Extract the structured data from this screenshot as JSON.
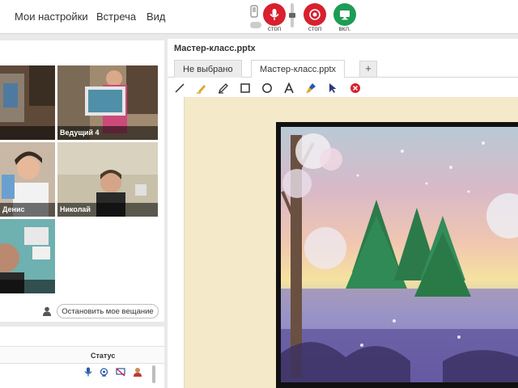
{
  "menu": {
    "settings": "Мои настройки",
    "meeting": "Встреча",
    "view": "Вид"
  },
  "media": {
    "mic_label": "стоп",
    "cam_label": "стоп",
    "screen_label": "вкл.",
    "accent_red": "#d8202e",
    "accent_green": "#1e9b55"
  },
  "videos": [
    {
      "name": "",
      "id": "v1"
    },
    {
      "name": "Ведущий 4",
      "id": "v2"
    },
    {
      "name": "Денис",
      "id": "v3"
    },
    {
      "name": "Николай",
      "id": "v4"
    },
    {
      "name": "",
      "id": "v5"
    }
  ],
  "stop_broadcast": "Остановить мое вещание",
  "list": {
    "status_header": "Статус"
  },
  "presentation": {
    "title": "Мастер-класс.pptx",
    "tabs": [
      "Не выбрано",
      "Мастер-класс.pptx"
    ],
    "add_tab": "+"
  }
}
